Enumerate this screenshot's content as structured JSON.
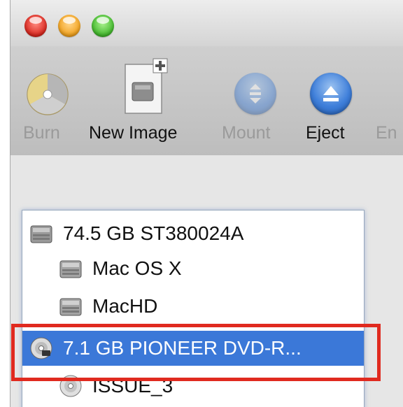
{
  "toolbar": {
    "burn_label": "Burn",
    "new_image_label": "New Image",
    "mount_label": "Mount",
    "eject_label": "Eject",
    "enable_label_partial": "En"
  },
  "sidebar": {
    "items": [
      {
        "label": "74.5 GB ST380024A",
        "icon": "hard-disk-icon",
        "level": 0,
        "selected": false
      },
      {
        "label": "Mac OS X",
        "icon": "volume-icon",
        "level": 1,
        "selected": false
      },
      {
        "label": "MacHD",
        "icon": "volume-icon",
        "level": 1,
        "selected": false
      },
      {
        "label": "7.1 GB PIONEER DVD-R...",
        "icon": "optical-disc-icon",
        "level": 0,
        "selected": true
      },
      {
        "label": "ISSUE_3",
        "icon": "disc-volume-icon",
        "level": 1,
        "selected": false
      }
    ]
  },
  "colors": {
    "selection": "#3b78d8",
    "highlight_box": "#e02a1f",
    "toolbar": "#c6c6c6"
  }
}
